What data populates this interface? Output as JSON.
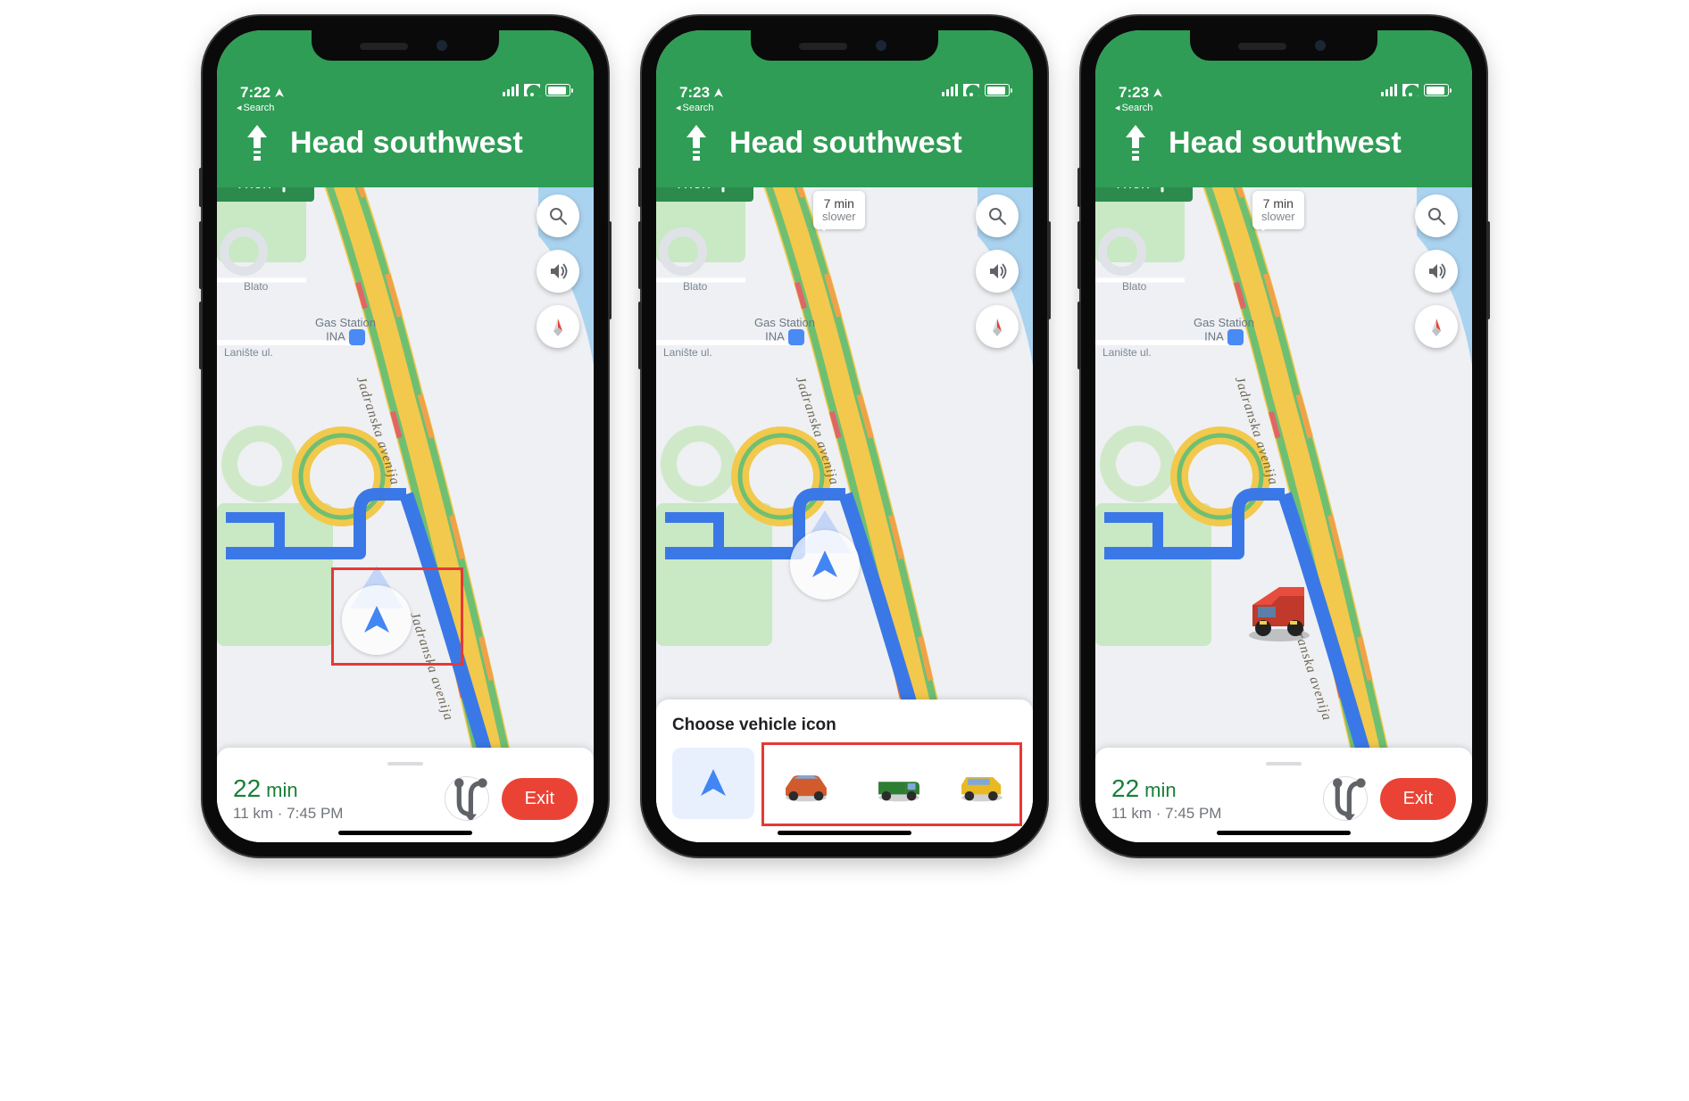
{
  "phones": [
    {
      "status": {
        "time": "7:22",
        "back_label": "Search"
      },
      "header": {
        "direction": "Head southwest",
        "then_label": "Then"
      },
      "map": {
        "gas_label": "Gas Station\nINA",
        "street_laniste": "Lanište ul.",
        "street_blato": "Blato",
        "road_name": "Jadranska avenija"
      },
      "eta": {
        "minutes": "22",
        "unit": "min",
        "distance": "11 km",
        "arrival": "7:45 PM",
        "exit_label": "Exit"
      }
    },
    {
      "status": {
        "time": "7:23",
        "back_label": "Search"
      },
      "header": {
        "direction": "Head southwest",
        "then_label": "Then"
      },
      "tooltip": {
        "line1": "7 min",
        "line2": "slower"
      },
      "map": {
        "gas_label": "Gas Station\nINA",
        "street_laniste": "Lanište ul.",
        "street_blato": "Blato",
        "road_name": "Jadranska avenija"
      },
      "vehicle": {
        "title": "Choose vehicle icon"
      }
    },
    {
      "status": {
        "time": "7:23",
        "back_label": "Search"
      },
      "header": {
        "direction": "Head southwest",
        "then_label": "Then"
      },
      "tooltip": {
        "line1": "7 min",
        "line2": "slower"
      },
      "map": {
        "gas_label": "Gas Station\nINA",
        "street_laniste": "Lanište ul.",
        "street_blato": "Blato",
        "road_name": "Jadranska avenija"
      },
      "eta": {
        "minutes": "22",
        "unit": "min",
        "distance": "11 km",
        "arrival": "7:45 PM",
        "exit_label": "Exit"
      }
    }
  ]
}
